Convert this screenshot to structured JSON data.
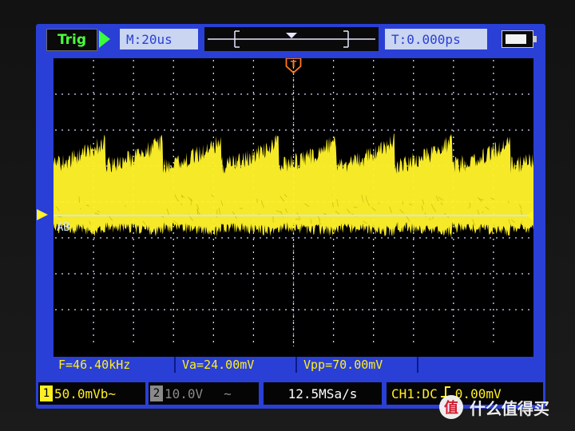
{
  "colors": {
    "screen_blue": "#2a3fd6",
    "trace_yellow": "#fff32a",
    "trig_green": "#4cff3c",
    "grid_dot": "#cfd6ff",
    "ref_line": "#cfe6ff",
    "label_box": "#c9d5f1",
    "trig_marker": "#ff7a1a"
  },
  "header": {
    "trig_label": "Trig",
    "time_base": "M:20us",
    "trigger_time": "T:0.000ps",
    "run_icon": "play-triangle-icon",
    "battery_icon": "battery-icon"
  },
  "waveform": {
    "channel_label": "AB",
    "trigger_marker_icon": "trigger-T-icon",
    "level_marker_icon": "triangle-marker-icon"
  },
  "measurements": {
    "frequency": "F=46.40kHz",
    "average": "Va=24.00mV",
    "vpp": "Vpp=70.00mV"
  },
  "footer": {
    "ch1_num": "1",
    "ch1_scale": "50.0mVb~",
    "ch2_num": "2",
    "ch2_scale": "10.0V",
    "ch2_coupling": "~",
    "sample_rate": "12.5MSa/s",
    "trigger_info": "CH1:DC",
    "trigger_level": "0.00mV"
  },
  "watermark": {
    "logo_text": "值",
    "text": "什么值得买"
  }
}
